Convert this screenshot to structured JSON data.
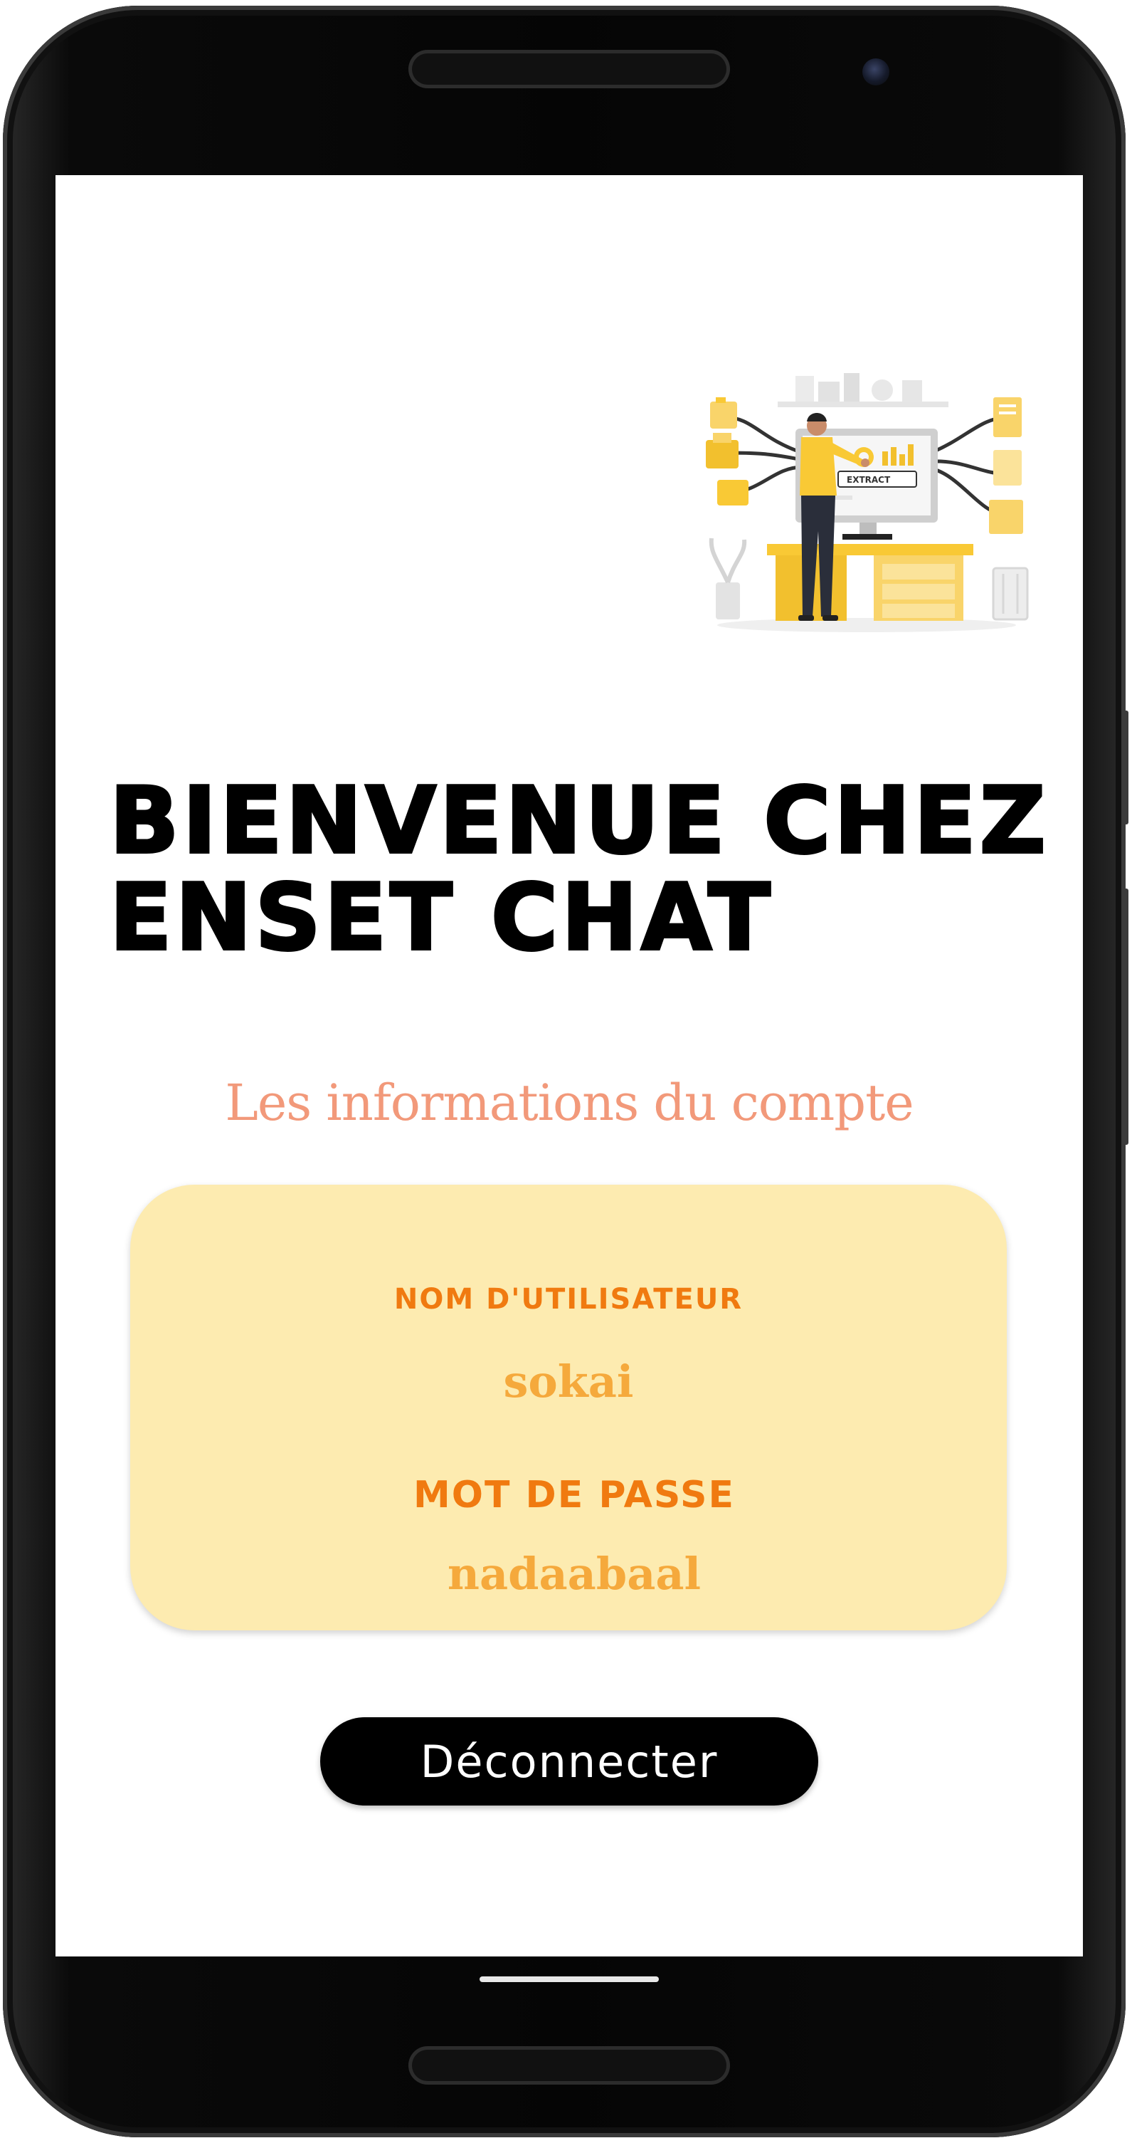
{
  "welcome": {
    "line1": "BIENVENUE CHEZ",
    "line2": "ENSET CHAT"
  },
  "account": {
    "section_title": "Les informations du compte",
    "username_label": "NOM D'UTILISATEUR",
    "username_value": "sokai",
    "password_label": "MOT DE PASSE",
    "password_value": "nadaabaal"
  },
  "actions": {
    "logout_label": "Déconnecter"
  },
  "illustration": {
    "screen_text": "EXTRACT"
  },
  "colors": {
    "section_title": "#f2997a",
    "card_background": "#fdebb0",
    "card_label": "#f07a10",
    "card_value": "#f5a93c",
    "button_background": "#000000",
    "illustration_accent": "#f9c935"
  }
}
